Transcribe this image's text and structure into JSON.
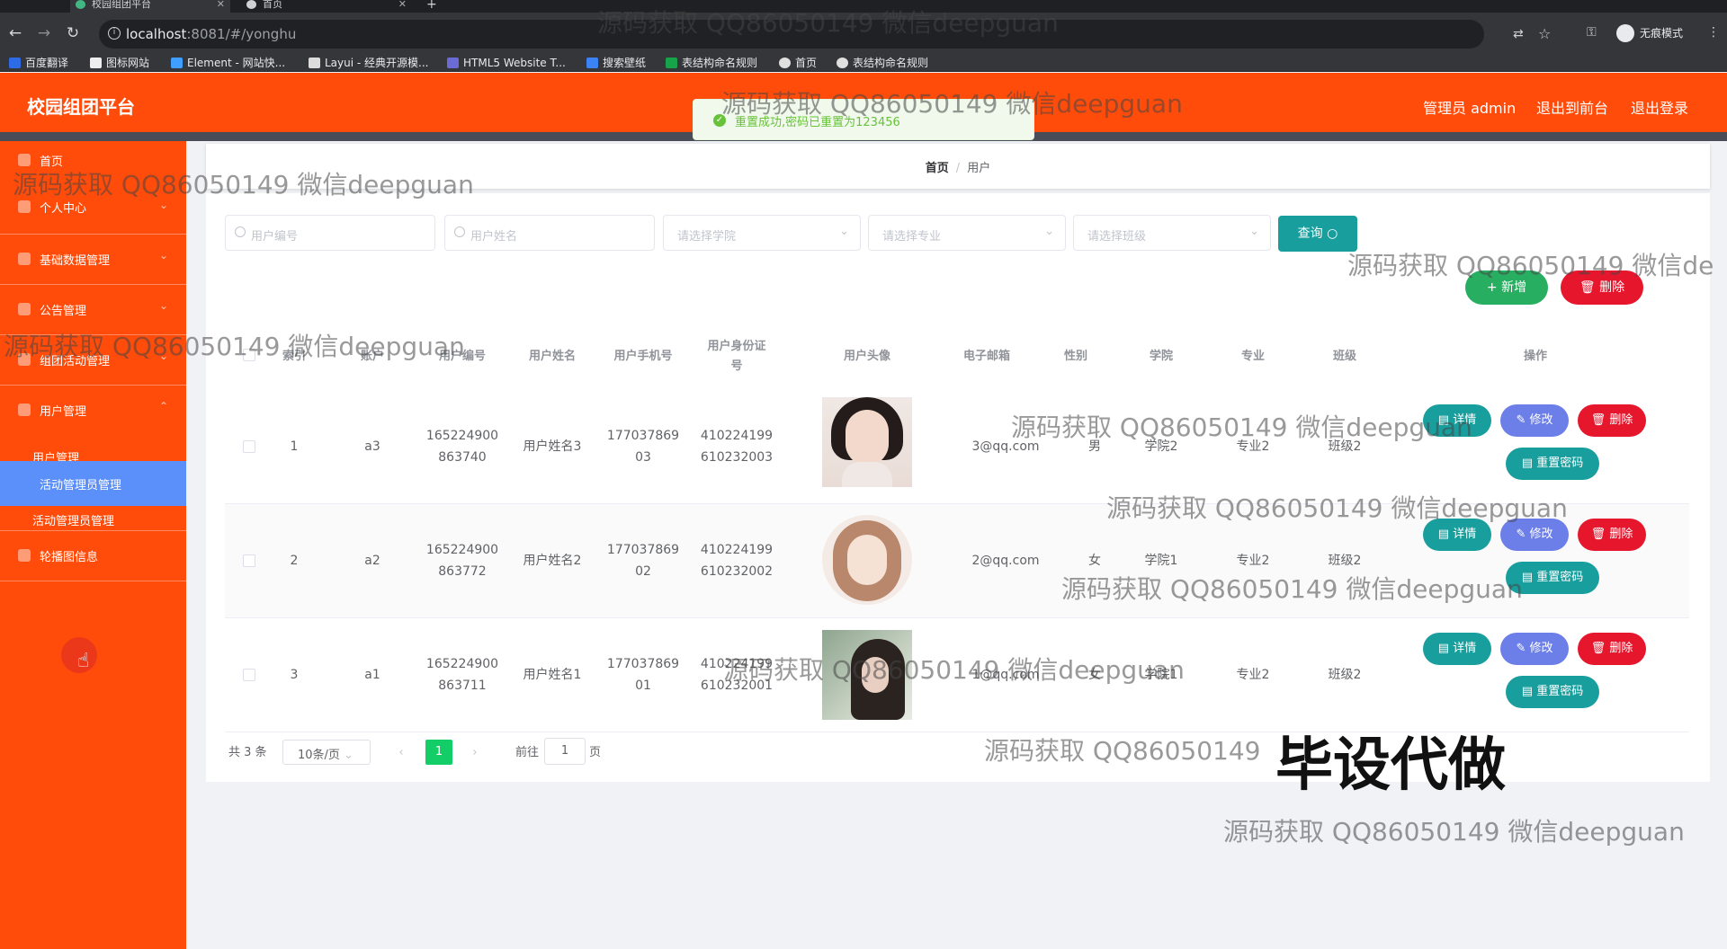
{
  "browser": {
    "tabs": [
      {
        "label": "校园组团平台"
      },
      {
        "label": "首页"
      }
    ],
    "url_host": "localhost",
    "url_rest": ":8081/#/yonghu",
    "incognito_label": "无痕模式",
    "bookmarks": [
      {
        "label": "百度翻译",
        "color": "#2e6be6"
      },
      {
        "label": "图标网站",
        "color": "#eeeeee"
      },
      {
        "label": "Element - 网站快...",
        "color": "#409eff"
      },
      {
        "label": "Layui - 经典开源模...",
        "color": "#dddddd"
      },
      {
        "label": "HTML5 Website T...",
        "color": "#6b6bd6"
      },
      {
        "label": "搜索壁纸",
        "color": "#3b82f6"
      },
      {
        "label": "表结构命名规则",
        "color": "#16a34a"
      },
      {
        "label": "首页",
        "color": "#e0e0e0"
      },
      {
        "label": "表结构命名规则",
        "color": "#e0e0e0"
      }
    ]
  },
  "header": {
    "title": "校园组团平台",
    "admin_label": "管理员 admin",
    "frontend_label": "退出到前台",
    "logout_label": "退出登录",
    "accent": "#ff4c0a"
  },
  "toast": {
    "message": "重置成功,密码已重置为123456"
  },
  "sidebar": {
    "items": [
      {
        "label": "首页"
      },
      {
        "label": "个人中心"
      },
      {
        "label": "基础数据管理"
      },
      {
        "label": "公告管理"
      },
      {
        "label": "组团活动管理"
      },
      {
        "label": "用户管理"
      }
    ],
    "sub_items": [
      {
        "label": "用户管理"
      },
      {
        "label": "活动管理员管理"
      },
      {
        "label": "活动管理员管理"
      }
    ],
    "last_item": {
      "label": "轮播图信息"
    }
  },
  "breadcrumb": {
    "home": "首页",
    "current": "用户"
  },
  "filters": {
    "user_no_placeholder": "用户编号",
    "user_name_placeholder": "用户姓名",
    "college_placeholder": "请选择学院",
    "major_placeholder": "请选择专业",
    "class_placeholder": "请选择班级",
    "query_label": "查询"
  },
  "actions": {
    "add_label": "新增",
    "delete_label": "删除"
  },
  "table": {
    "headers": {
      "index": "索引",
      "account": "账户",
      "user_no": "用户编号",
      "user_name": "用户姓名",
      "phone": "用户手机号",
      "id_card_line1": "用户身份证",
      "id_card_line2": "号",
      "photo": "用户头像",
      "email": "电子邮箱",
      "gender": "性别",
      "college": "学院",
      "major": "专业",
      "class": "班级",
      "ops": "操作"
    },
    "rows": [
      {
        "index": "1",
        "account": "a3",
        "no1": "165224900",
        "no2": "863740",
        "name": "用户姓名3",
        "ph1": "177037869",
        "ph2": "03",
        "id1": "410224199",
        "id2": "610232003",
        "email": "3@qq.com",
        "gender": "男",
        "college": "学院2",
        "major": "专业2",
        "cls": "班级2"
      },
      {
        "index": "2",
        "account": "a2",
        "no1": "165224900",
        "no2": "863772",
        "name": "用户姓名2",
        "ph1": "177037869",
        "ph2": "02",
        "id1": "410224199",
        "id2": "610232002",
        "email": "2@qq.com",
        "gender": "女",
        "college": "学院1",
        "major": "专业2",
        "cls": "班级2"
      },
      {
        "index": "3",
        "account": "a1",
        "no1": "165224900",
        "no2": "863711",
        "name": "用户姓名1",
        "ph1": "177037869",
        "ph2": "01",
        "id1": "410224199",
        "id2": "610232001",
        "email": "1@qq.com",
        "gender": "女",
        "college": "学院1",
        "major": "专业2",
        "cls": "班级2"
      }
    ],
    "op_labels": {
      "detail": "详情",
      "edit": "修改",
      "delete": "删除",
      "reset": "重置密码"
    }
  },
  "pagination": {
    "total": "共 3 条",
    "page_size": "10条/页",
    "current_page": "1",
    "goto_label": "前往",
    "goto_value": "1",
    "page_unit": "页"
  },
  "watermarks": {
    "text": "源码获取 QQ86050149 微信deepguan",
    "truncated": "源码获取 QQ86050149 微信de",
    "partial": "源码获取 QQ86050149",
    "big": "毕设代做"
  }
}
